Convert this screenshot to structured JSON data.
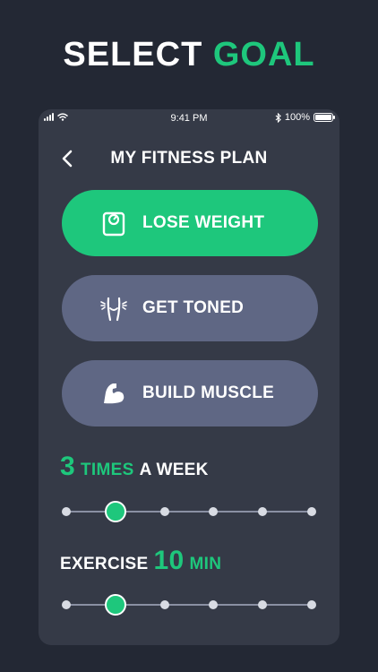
{
  "headline": {
    "part1": "SELECT",
    "part2": "GOAL"
  },
  "status_bar": {
    "time": "9:41 PM",
    "battery": "100%"
  },
  "header": {
    "title": "MY FITNESS PLAN"
  },
  "goals": [
    {
      "label": "LOSE WEIGHT",
      "icon": "scale-icon",
      "selected": true
    },
    {
      "label": "GET TONED",
      "icon": "body-toned-icon",
      "selected": false
    },
    {
      "label": "BUILD MUSCLE",
      "icon": "flexed-bicep-icon",
      "selected": false
    }
  ],
  "frequency": {
    "value": "3",
    "unit": "TIMES",
    "suffix": "A WEEK",
    "steps": 6,
    "selected_index": 1
  },
  "duration": {
    "prefix": "EXERCISE",
    "value": "10",
    "unit": "MIN",
    "steps": 6,
    "selected_index": 1
  },
  "colors": {
    "background": "#232834",
    "panel": "#353a47",
    "accent": "#1ec77c",
    "option": "#5f6784"
  }
}
